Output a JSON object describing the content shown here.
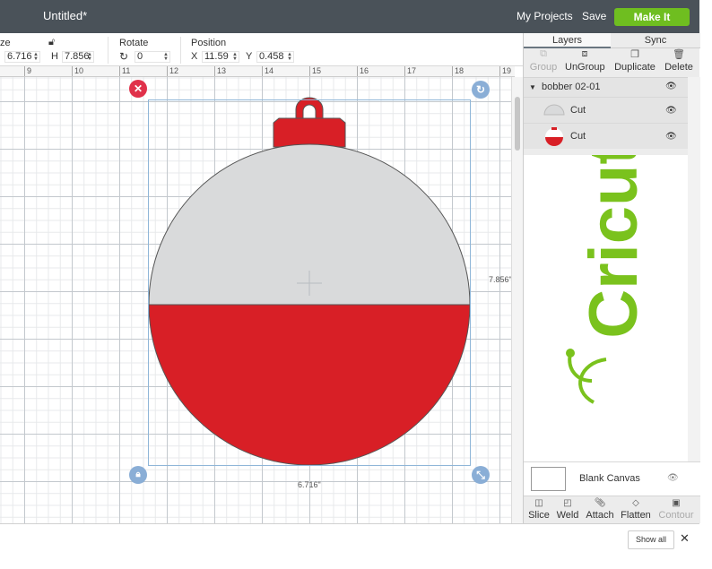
{
  "header": {
    "title": "Untitled*",
    "my_projects": "My Projects",
    "save": "Save",
    "make_it": "Make It"
  },
  "edit_bar": {
    "size_label": "ze",
    "width_value": "6.716",
    "height_label": "H",
    "height_value": "7.856",
    "rotate_label": "Rotate",
    "rotate_value": "0",
    "position_label": "Position",
    "x_label": "X",
    "x_value": "11.59",
    "y_label": "Y",
    "y_value": "0.458"
  },
  "ruler": [
    "9",
    "10",
    "11",
    "12",
    "13",
    "14",
    "15",
    "16",
    "17",
    "18",
    "19"
  ],
  "canvas": {
    "width_dim": "6.716\"",
    "height_dim": "7.856\"",
    "colors": {
      "top_half": "#d9dadb",
      "bottom_half": "#d81f26",
      "handle_delete": "#e0314a",
      "handle_other": "#8aaed6"
    }
  },
  "panel": {
    "tabs": [
      "Layers",
      "Sync"
    ],
    "tools": [
      "Group",
      "UnGroup",
      "Duplicate",
      "Delete"
    ],
    "layer_group": "bobber 02-01",
    "layers": [
      {
        "label": "Cut",
        "thumb": "gray-half"
      },
      {
        "label": "Cut",
        "thumb": "red-half"
      }
    ],
    "logo_text": "Cricut",
    "logo_color": "#7ac21d",
    "blank_canvas": "Blank Canvas",
    "bottom_tools": [
      "Slice",
      "Weld",
      "Attach",
      "Flatten",
      "Contour"
    ]
  },
  "downloads": {
    "show_all": "Show all",
    "close": "✕"
  }
}
